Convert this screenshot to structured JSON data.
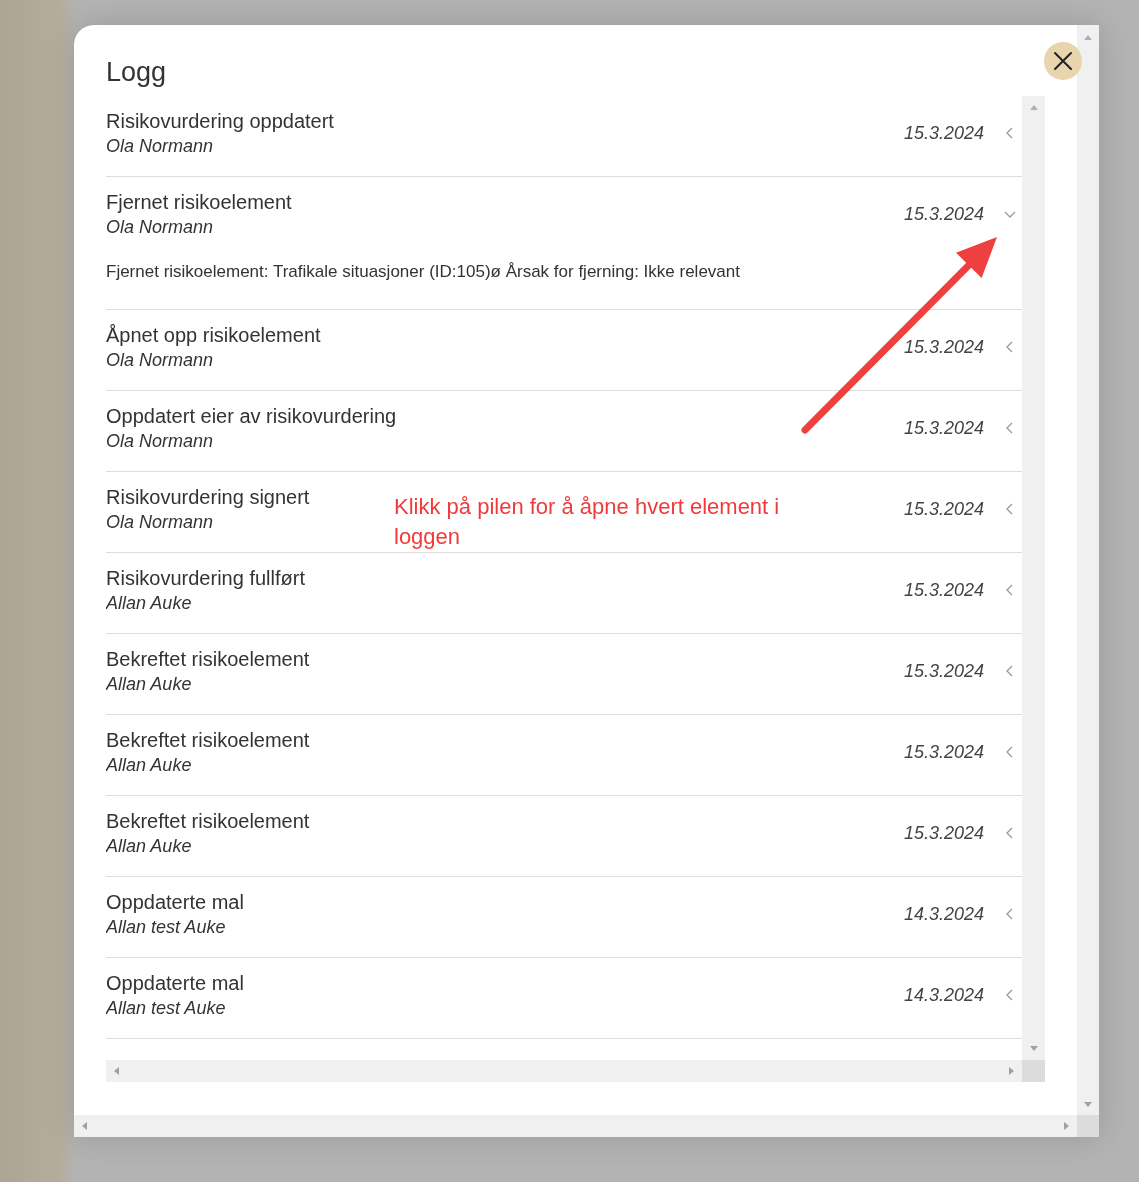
{
  "dialog": {
    "title": "Logg"
  },
  "entries": [
    {
      "title": "Risikovurdering oppdatert",
      "user": "Ola Normann",
      "date": "15.3.2024",
      "expanded": false
    },
    {
      "title": "Fjernet risikoelement",
      "user": "Ola Normann",
      "date": "15.3.2024",
      "expanded": true,
      "details": "Fjernet risikoelement: Trafikale situasjoner (ID:105)ø Årsak for fjerning: Ikke relevant"
    },
    {
      "title": "Åpnet opp risikoelement",
      "user": "Ola Normann",
      "date": "15.3.2024",
      "expanded": false
    },
    {
      "title": "Oppdatert eier av risikovurdering",
      "user": "Ola Normann",
      "date": "15.3.2024",
      "expanded": false
    },
    {
      "title": "Risikovurdering signert",
      "user": "Ola Normann",
      "date": "15.3.2024",
      "expanded": false
    },
    {
      "title": "Risikovurdering fullført",
      "user": "Allan Auke",
      "date": "15.3.2024",
      "expanded": false
    },
    {
      "title": "Bekreftet risikoelement",
      "user": "Allan Auke",
      "date": "15.3.2024",
      "expanded": false
    },
    {
      "title": "Bekreftet risikoelement",
      "user": "Allan Auke",
      "date": "15.3.2024",
      "expanded": false
    },
    {
      "title": "Bekreftet risikoelement",
      "user": "Allan Auke",
      "date": "15.3.2024",
      "expanded": false
    },
    {
      "title": "Oppdaterte mal",
      "user": "Allan test Auke",
      "date": "14.3.2024",
      "expanded": false
    },
    {
      "title": "Oppdaterte mal",
      "user": "Allan test Auke",
      "date": "14.3.2024",
      "expanded": false
    }
  ],
  "annotation": {
    "text": "Klikk på pilen for å åpne hvert element i loggen"
  }
}
